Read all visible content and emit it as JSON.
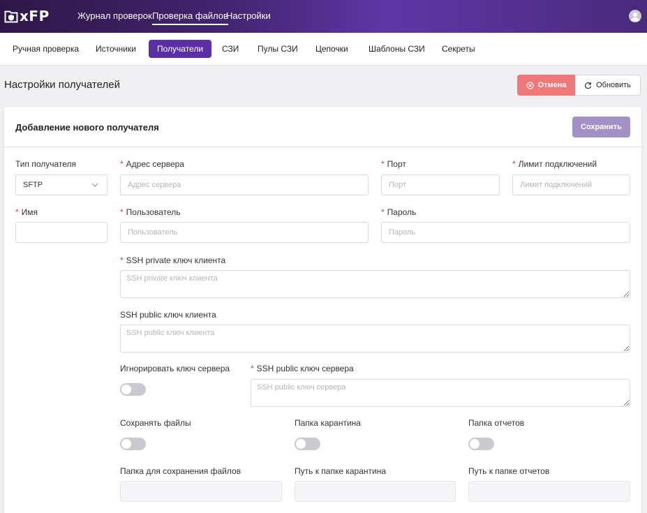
{
  "app": {
    "logo_text": "xFP"
  },
  "topnav": {
    "items": [
      "Журнал проверок",
      "Проверка файлов",
      "Настройки"
    ]
  },
  "subnav": {
    "items": [
      "Ручная проверка",
      "Источники",
      "Получатели",
      "СЗИ",
      "Пулы СЗИ",
      "Цепочки",
      "Шаблоны СЗИ",
      "Секреты"
    ]
  },
  "page": {
    "title": "Настройки получателей",
    "cancel_label": "Отмена",
    "refresh_label": "Обновить"
  },
  "form": {
    "title": "Добавление нового получателя",
    "save_label": "Сохранить",
    "recipient_type": {
      "label": "Тип получателя",
      "value": "SFTP"
    },
    "server_address": {
      "label": "Адрес сервера",
      "placeholder": "Адрес сервера"
    },
    "port": {
      "label": "Порт",
      "placeholder": "Порт"
    },
    "conn_limit": {
      "label": "Лимит подключений",
      "placeholder": "Лимит подключений"
    },
    "name": {
      "label": "Имя",
      "placeholder": ""
    },
    "user": {
      "label": "Пользователь",
      "placeholder": "Пользователь"
    },
    "password": {
      "label": "Пароль",
      "placeholder": "Пароль"
    },
    "ssh_private": {
      "label": "SSH private ключ клиента",
      "placeholder": "SSH private ключ клиента"
    },
    "ssh_public_client": {
      "label": "SSH public ключ клиента",
      "placeholder": "SSH public ключ клиента"
    },
    "ignore_server_key": {
      "label": "Игнорировать ключ сервера"
    },
    "ssh_public_server": {
      "label": "SSH public ключ сервера",
      "placeholder": "SSH public ключ сервера"
    },
    "save_files": {
      "label": "Сохранять файлы"
    },
    "quarantine_folder": {
      "label": "Папка карантина"
    },
    "reports_folder": {
      "label": "Папка отчетов"
    },
    "save_files_folder": {
      "label": "Папка для сохранения файлов"
    },
    "quarantine_path": {
      "label": "Путь к папке карантина"
    },
    "reports_path": {
      "label": "Путь к папке отчетов"
    }
  },
  "colors": {
    "accent": "#5b2ea6",
    "cancel": "#f07878",
    "save": "#a291c6",
    "required": "#e53935"
  }
}
